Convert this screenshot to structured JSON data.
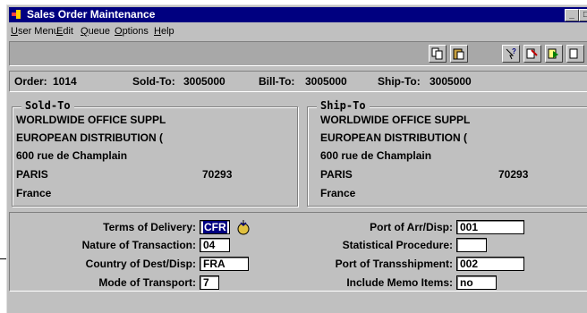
{
  "window": {
    "title": "Sales Order Maintenance",
    "buttons": [
      "_",
      "□"
    ]
  },
  "menu": [
    {
      "label": "User Menu",
      "accel": "U"
    },
    {
      "label": "Edit",
      "accel": "E"
    },
    {
      "label": "Queue",
      "accel": "Q"
    },
    {
      "label": "Options",
      "accel": "O"
    },
    {
      "label": "Help",
      "accel": "H"
    }
  ],
  "toolbar_icons": [
    "copy-icon",
    "paste-icon",
    "help-query-icon",
    "edit-query-icon",
    "browse-icon",
    "tool-icon"
  ],
  "header": {
    "order_label": "Order:",
    "order_value": "1014",
    "sold_to_label": "Sold-To:",
    "sold_to_value": "3005000",
    "bill_to_label": "Bill-To:",
    "bill_to_value": "3005000",
    "ship_to_label": "Ship-To:",
    "ship_to_value": "3005000"
  },
  "sold_to": {
    "title": "Sold-To",
    "name": "WORLDWIDE OFFICE SUPPL",
    "line2": "EUROPEAN DISTRIBUTION (",
    "address": "600 rue de Champlain",
    "city": "PARIS",
    "zip": "70293",
    "country": "France"
  },
  "ship_to": {
    "title": "Ship-To",
    "name": "WORLDWIDE OFFICE SUPPL",
    "line2": "EUROPEAN DISTRIBUTION (",
    "address": "600 rue de Champlain",
    "city": "PARIS",
    "zip": "70293",
    "country": "France"
  },
  "fields": {
    "terms_label": "Terms of Delivery:",
    "terms_value": "CFR",
    "nature_label": "Nature of Transaction:",
    "nature_value": "04",
    "country_label": "Country of Dest/Disp:",
    "country_value": "FRA",
    "mode_label": "Mode of Transport:",
    "mode_value": "7",
    "port_label": "Port of Arr/Disp:",
    "port_value": "001",
    "stat_label": "Statistical Procedure:",
    "stat_value": "",
    "trans_label": "Port of Transshipment:",
    "trans_value": "002",
    "memo_label": "Include Memo Items:",
    "memo_value": "no"
  }
}
